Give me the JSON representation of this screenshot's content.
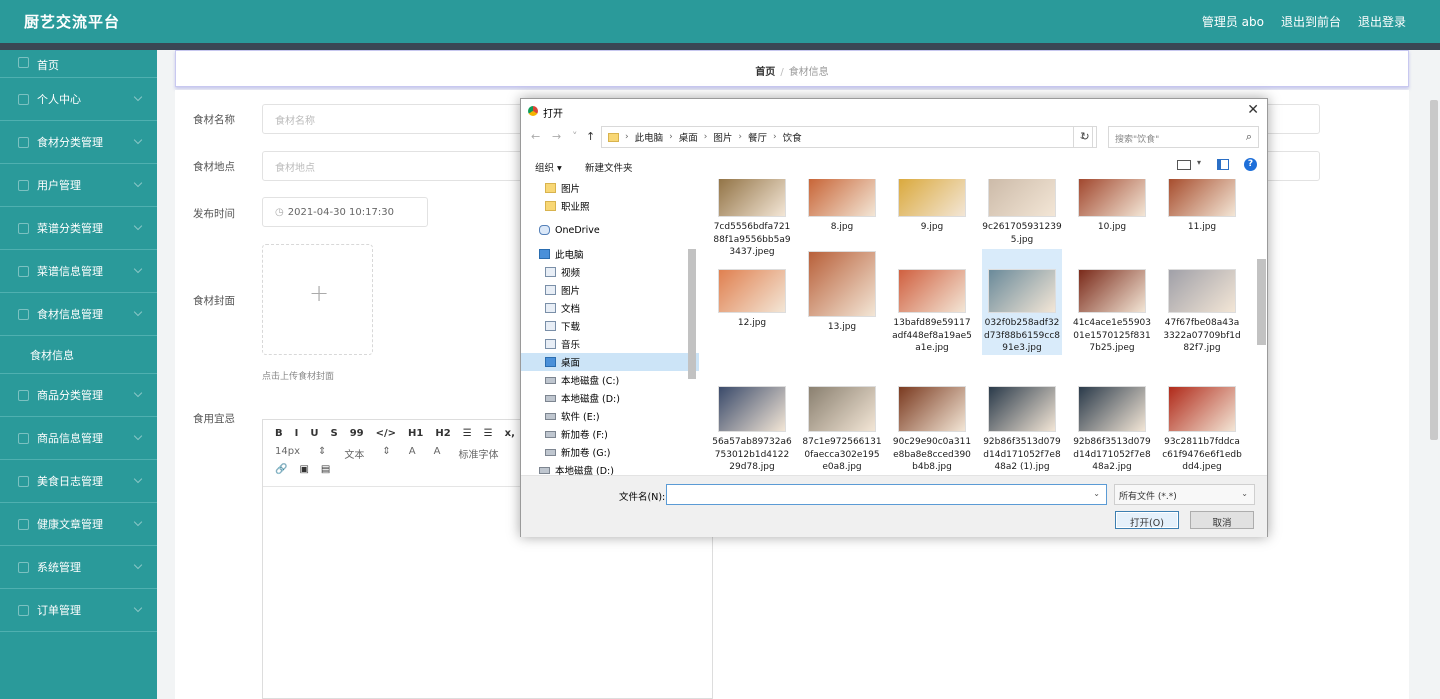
{
  "app": {
    "brand": "厨艺交流平台",
    "admin_label": "管理员 abo",
    "to_front": "退出到前台",
    "logout": "退出登录"
  },
  "sidebar": {
    "items": [
      {
        "label": "首页",
        "icon": "home-icon"
      },
      {
        "label": "个人中心",
        "icon": "user-icon"
      },
      {
        "label": "食材分类管理",
        "icon": "folder-icon"
      },
      {
        "label": "用户管理",
        "icon": "list-icon"
      },
      {
        "label": "菜谱分类管理",
        "icon": "tag-icon"
      },
      {
        "label": "菜谱信息管理",
        "icon": "book-icon"
      },
      {
        "label": "食材信息管理",
        "icon": "clock-icon"
      },
      {
        "label": "食材信息",
        "icon": ""
      },
      {
        "label": "商品分类管理",
        "icon": "circle-icon"
      },
      {
        "label": "商品信息管理",
        "icon": "check-icon"
      },
      {
        "label": "美食日志管理",
        "icon": "thumb-icon"
      },
      {
        "label": "健康文章管理",
        "icon": "heart-icon"
      },
      {
        "label": "系统管理",
        "icon": "bar-icon"
      },
      {
        "label": "订单管理",
        "icon": "mic-icon"
      }
    ]
  },
  "breadcrumb": {
    "home": "首页",
    "sep": "/",
    "current": "食材信息"
  },
  "form": {
    "name_label": "食材名称",
    "name_placeholder": "食材名称",
    "place_label": "食材地点",
    "place_placeholder": "食材地点",
    "time_label": "发布时间",
    "time_value": "2021-04-30 10:17:30",
    "cover_label": "食材封面",
    "cover_hint": "点击上传食材封面",
    "content_label": "食用宜忌"
  },
  "editor": {
    "row1": [
      "B",
      "I",
      "U",
      "S",
      "99",
      "</>",
      "H1",
      "H2",
      "☰",
      "☰",
      "x,"
    ],
    "row2": [
      "14px",
      "⇕",
      "文本",
      "⇕",
      "A",
      "A",
      "标准字体"
    ],
    "row3": [
      "🔗",
      "▣",
      "▤"
    ]
  },
  "dialog": {
    "title": "打开",
    "path": [
      "此电脑",
      "桌面",
      "图片",
      "餐厅",
      "饮食"
    ],
    "search_placeholder": "搜索\"饮食\"",
    "organize": "组织 ▾",
    "new_folder": "新建文件夹",
    "tree": [
      {
        "label": "图片",
        "type": "fold",
        "indent": 24
      },
      {
        "label": "职业照",
        "type": "fold",
        "indent": 24
      },
      {
        "label": "OneDrive",
        "type": "od",
        "indent": 18
      },
      {
        "label": "此电脑",
        "type": "pc",
        "indent": 18
      },
      {
        "label": "视频",
        "type": "std",
        "indent": 24
      },
      {
        "label": "图片",
        "type": "std",
        "indent": 24
      },
      {
        "label": "文档",
        "type": "std",
        "indent": 24
      },
      {
        "label": "下载",
        "type": "std",
        "indent": 24
      },
      {
        "label": "音乐",
        "type": "std",
        "indent": 24
      },
      {
        "label": "桌面",
        "type": "pc",
        "indent": 24,
        "selected": true
      },
      {
        "label": "本地磁盘 (C:)",
        "type": "dk",
        "indent": 24
      },
      {
        "label": "本地磁盘 (D:)",
        "type": "dk",
        "indent": 24
      },
      {
        "label": "软件 (E:)",
        "type": "dk",
        "indent": 24
      },
      {
        "label": "新加卷 (F:)",
        "type": "dk",
        "indent": 24
      },
      {
        "label": "新加卷 (G:)",
        "type": "dk",
        "indent": 24
      },
      {
        "label": "本地磁盘 (D:)",
        "type": "dk",
        "indent": 18
      }
    ],
    "files": [
      {
        "name": "7cd5556bdfa72188f1a9556bb5a93437.jpeg",
        "color": "#8a6a3a"
      },
      {
        "name": "8.jpg",
        "color": "#c45a2a"
      },
      {
        "name": "9.jpg",
        "color": "#d8a430"
      },
      {
        "name": "9c2617059312395.jpg",
        "color": "#c9b7a5"
      },
      {
        "name": "10.jpg",
        "color": "#9a3a20"
      },
      {
        "name": "11.jpg",
        "color": "#a0401f"
      },
      {
        "name": "12.jpg",
        "color": "#e08050"
      },
      {
        "name": "13.jpg",
        "color": "#b8603a"
      },
      {
        "name": "13bafd89e59117adf448ef8a19ae5a1e.jpg",
        "color": "#d06040"
      },
      {
        "name": "032f0b258adf32d73f88b6159cc891e3.jpg",
        "color": "#6a8a9a",
        "selected": true
      },
      {
        "name": "41c4ace1e5590301e1570125f8317b25.jpeg",
        "color": "#7a2a1a"
      },
      {
        "name": "47f67fbe08a43a3322a07709bf1d82f7.jpg",
        "color": "#a0a0a8"
      },
      {
        "name": "56a57ab89732a6753012b1d412229d78.jpg",
        "color": "#3a4a6a"
      },
      {
        "name": "87c1e9725661310faecca302e195e0a8.jpg",
        "color": "#8a8070"
      },
      {
        "name": "90c29e90c0a311e8ba8e8cced390b4b8.jpg",
        "color": "#7a3a20"
      },
      {
        "name": "92b86f3513d079d14d171052f7e848a2 (1).jpg",
        "color": "#2a3a4a"
      },
      {
        "name": "92b86f3513d079d14d171052f7e848a2.jpg",
        "color": "#2a3a4a"
      },
      {
        "name": "93c2811b7fddcac61f9476e6f1edbdd4.jpeg",
        "color": "#b02a1a"
      }
    ],
    "filename_label": "文件名(N):",
    "filetype": "所有文件 (*.*)",
    "open_btn": "打开(O)",
    "cancel_btn": "取消"
  }
}
